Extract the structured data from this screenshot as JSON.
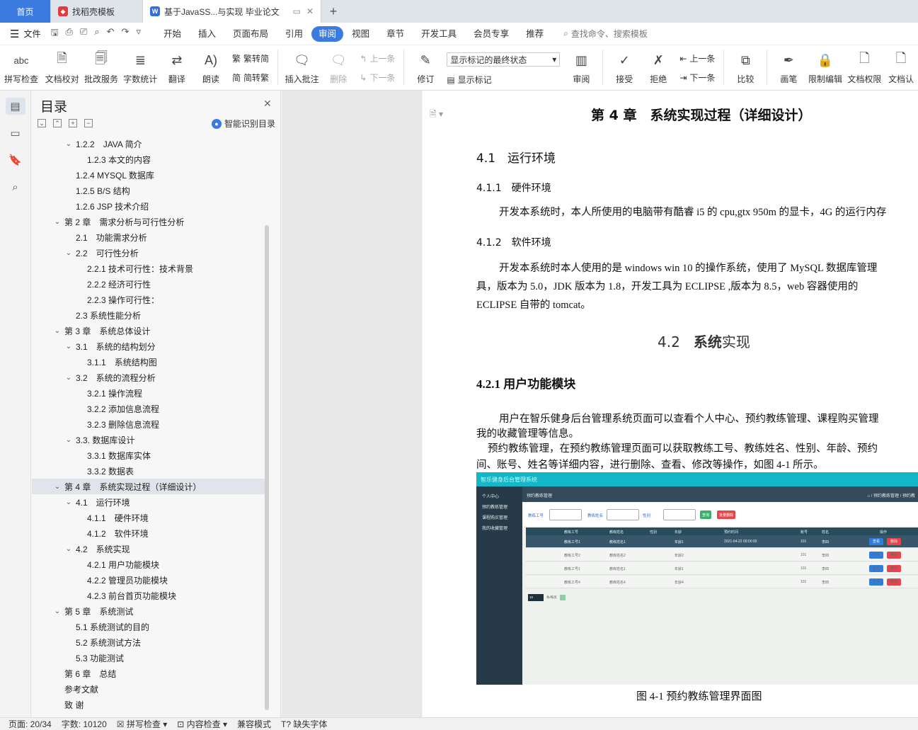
{
  "tabs": {
    "home": "首页",
    "template": "找稻壳模板",
    "document": "基于JavaSS...与实现 毕业论文",
    "new_tab": "+"
  },
  "menubar": {
    "file": "文件",
    "items": [
      "开始",
      "插入",
      "页面布局",
      "引用",
      "审阅",
      "视图",
      "章节",
      "开发工具",
      "会员专享",
      "推荐"
    ],
    "active": "审阅",
    "search": "查找命令、搜索模板"
  },
  "ribbon": {
    "spell_check": "拼写检查",
    "doc_proofread": "文档校对",
    "batch_service": "批改服务",
    "word_count": "字数统计",
    "translate": "翻译",
    "read_aloud": "朗读",
    "trad_to_simp": "繁转简",
    "simp_to_trad": "简转繁",
    "insert_comment": "插入批注",
    "delete": "删除",
    "prev": "上一条",
    "next": "下一条",
    "track_changes": "修订",
    "markup_select": "显示标记的最终状态",
    "show_markup": "显示标记",
    "review": "审阅",
    "accept": "接受",
    "reject": "拒绝",
    "prev2": "上一条",
    "next2": "下一条",
    "compare": "比较",
    "pen": "画笔",
    "restrict_edit": "限制编辑",
    "doc_permission": "文档权限",
    "doc_cert": "文档认"
  },
  "toc": {
    "title": "目录",
    "smart": "智能识别目录",
    "items": [
      {
        "text": "1.2.2　JAVA 简介",
        "level": 2,
        "arrow": true
      },
      {
        "text": "1.2.3  本文的内容",
        "level": 3,
        "arrow": false
      },
      {
        "text": "1.2.4 MYSQL 数据库",
        "level": 2,
        "arrow": false
      },
      {
        "text": "1.2.5 B/S 结构",
        "level": 2,
        "arrow": false
      },
      {
        "text": "1.2.6 JSP 技术介绍",
        "level": 2,
        "arrow": false
      },
      {
        "text": "第 2 章　需求分析与可行性分析",
        "level": 1,
        "arrow": true
      },
      {
        "text": "2.1　功能需求分析",
        "level": 2,
        "arrow": false
      },
      {
        "text": "2.2　可行性分析",
        "level": 2,
        "arrow": true
      },
      {
        "text": "2.2.1 技术可行性：技术背景",
        "level": 3,
        "arrow": false
      },
      {
        "text": "2.2.2 经济可行性",
        "level": 3,
        "arrow": false
      },
      {
        "text": "2.2.3 操作可行性：",
        "level": 3,
        "arrow": false
      },
      {
        "text": "2.3  系统性能分析",
        "level": 2,
        "arrow": false
      },
      {
        "text": "第 3 章　系统总体设计",
        "level": 1,
        "arrow": true
      },
      {
        "text": "3.1　系统的结构划分",
        "level": 2,
        "arrow": true
      },
      {
        "text": "3.1.1　系统结构图",
        "level": 3,
        "arrow": false
      },
      {
        "text": "3.2　系统的流程分析",
        "level": 2,
        "arrow": true
      },
      {
        "text": "3.2.1 操作流程",
        "level": 3,
        "arrow": false
      },
      {
        "text": "3.2.2 添加信息流程",
        "level": 3,
        "arrow": false
      },
      {
        "text": "3.2.3 删除信息流程",
        "level": 3,
        "arrow": false
      },
      {
        "text": "3.3.  数据库设计",
        "level": 2,
        "arrow": true
      },
      {
        "text": "3.3.1  数据库实体",
        "level": 3,
        "arrow": false
      },
      {
        "text": "3.3.2 数据表",
        "level": 3,
        "arrow": false
      },
      {
        "text": "第 4 章　系统实现过程（详细设计）",
        "level": 1,
        "arrow": true,
        "selected": true
      },
      {
        "text": "4.1　运行环境",
        "level": 2,
        "arrow": true
      },
      {
        "text": "4.1.1　硬件环境",
        "level": 3,
        "arrow": false
      },
      {
        "text": "4.1.2　软件环境",
        "level": 3,
        "arrow": false
      },
      {
        "text": "4.2　系统实现",
        "level": 2,
        "arrow": true
      },
      {
        "text": "4.2.1 用户功能模块",
        "level": 3,
        "arrow": false
      },
      {
        "text": "4.2.2 管理员功能模块",
        "level": 3,
        "arrow": false
      },
      {
        "text": "4.2.3 前台首页功能模块",
        "level": 3,
        "arrow": false
      },
      {
        "text": "第 5 章　系统测试",
        "level": 1,
        "arrow": true
      },
      {
        "text": "5.1 系统测试的目的",
        "level": 2,
        "arrow": false
      },
      {
        "text": "5.2 系统测试方法",
        "level": 2,
        "arrow": false
      },
      {
        "text": "5.3 功能测试",
        "level": 2,
        "arrow": false
      },
      {
        "text": "第 6 章　总结",
        "level": 1,
        "arrow": false
      },
      {
        "text": "参考文献",
        "level": 1,
        "arrow": false
      },
      {
        "text": "致  谢",
        "level": 1,
        "arrow": false
      }
    ]
  },
  "document": {
    "chapter": "第 4 章　系统实现过程（详细设计）",
    "s41": "4.1　运行环境",
    "s411": "4.1.1　硬件环境",
    "p_hw": "开发本系统时，本人所使用的电脑带有酷睿 i5 的 cpu,gtx 950m 的显卡，4G 的运行内存",
    "s412": "4.1.2　软件环境",
    "p_sw1": "开发本系统时本人使用的是 windows win 10 的操作系统，使用了 MySQL 数据库管理",
    "p_sw2": "具，版本为 5.0，JDK 版本为 1.8，开发工具为 ECLIPSE ,版本为 8.5，web 容器使用的",
    "p_sw3": "ECLIPSE  自带的 tomcat。",
    "s42_num": "4.2",
    "s42_bold": "系统",
    "s42_rest": "实现",
    "s421": "4.2.1 用户功能模块",
    "p_u1": "用户在智乐健身后台管理系统页面可以查看个人中心、预约教练管理、课程购买管理",
    "p_u2": "我的收藏管理等信息。",
    "p_u3": "预约教练管理，在预约教练管理页面可以获取教练工号、教练姓名、性别、年龄、预约",
    "p_u4": "间、账号、姓名等详细内容，进行删除、查看、修改等操作，如图 4-1 所示。",
    "caption": "图 4-1 预约教练管理界面图"
  },
  "figure": {
    "app_title": "智乐健身后台管理系统",
    "side_items": [
      "个人中心",
      "预约教练管理",
      "课程购买管理",
      "我的收藏管理"
    ],
    "crumb": "预约教练管理",
    "crumb_right": "⌂ / 预约教练管理 / 预约教",
    "filters": [
      "教练工号",
      "教练姓名",
      "性别"
    ],
    "btn_search": "查询",
    "btn_batch_delete": "批量删除",
    "columns": [
      "教练工号",
      "教练姓名",
      "性别",
      "年龄",
      "预约时间",
      "账号",
      "姓名",
      "操作"
    ],
    "rows": [
      [
        "教练工号1",
        "教练姓名1",
        "",
        "年龄1",
        "2021-04-22 00:00:00",
        "101",
        "李四"
      ],
      [
        "教练工号2",
        "教练姓名2",
        "",
        "年龄2",
        "",
        "101",
        "李四"
      ],
      [
        "教练工号1",
        "教练姓名1",
        "",
        "年龄1",
        "",
        "101",
        "李四"
      ],
      [
        "教练工号4",
        "教练姓名4",
        "",
        "年龄4",
        "",
        "101",
        "李四"
      ]
    ],
    "view": "查看",
    "del": "删除",
    "page_size": "10",
    "pager_text": "条/每页",
    "colors": {
      "topbar": "#13b8c8",
      "side": "#263b47",
      "view_btn": "#2f7de1",
      "delete_btn": "#e9434b",
      "search_btn": "#3cb06b"
    }
  },
  "status": {
    "page": "页面: 20/34",
    "words": "字数: 10120",
    "spell": "拼写检查",
    "content_check": "内容检查",
    "compat": "兼容模式",
    "missing_font": "缺失字体"
  },
  "colors": {
    "accent": "#3b7be0"
  }
}
